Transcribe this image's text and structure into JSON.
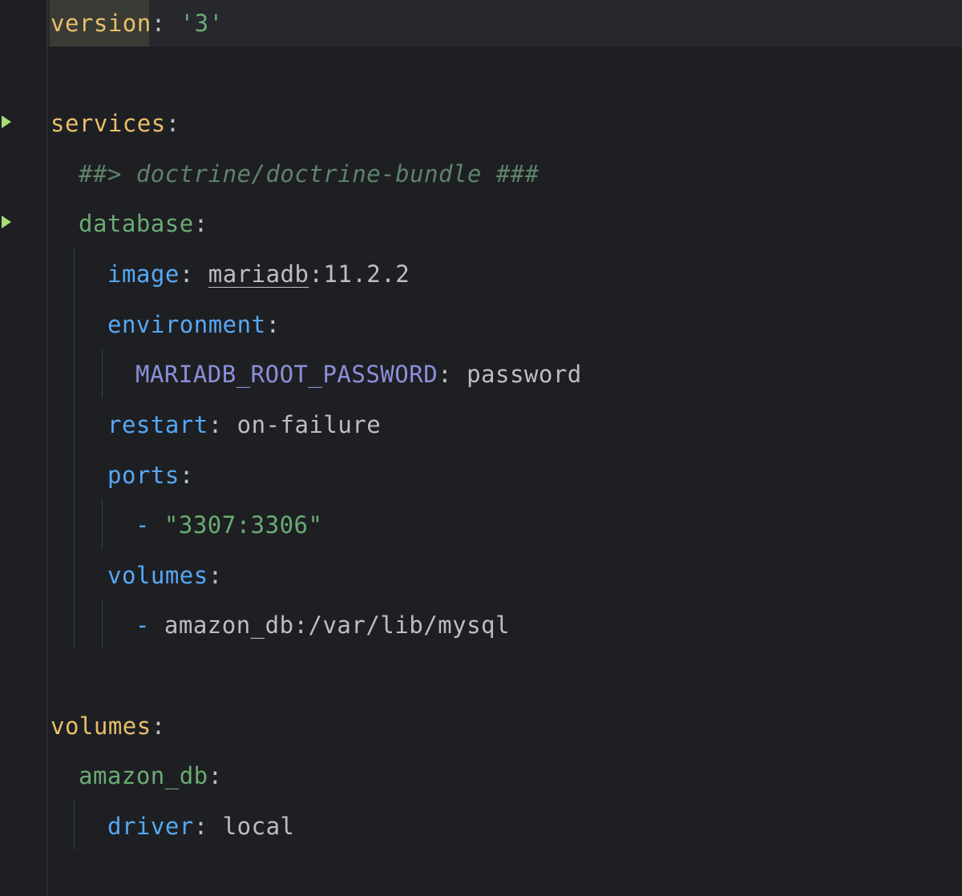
{
  "yaml": {
    "version": {
      "key": "version",
      "colon": ":",
      "value": "'3'"
    },
    "services": {
      "key": "services",
      "colon": ":"
    },
    "comment": "##> doctrine/doctrine-bundle ###",
    "database": {
      "key": "database",
      "colon": ":"
    },
    "image": {
      "key": "image",
      "colon": ": ",
      "value_name": "mariadb",
      "value_tag": ":11.2.2"
    },
    "environment": {
      "key": "environment",
      "colon": ":"
    },
    "root_password": {
      "key": "MARIADB_ROOT_PASSWORD",
      "colon": ": ",
      "value": "password"
    },
    "restart": {
      "key": "restart",
      "colon": ": ",
      "value": "on-failure"
    },
    "ports": {
      "key": "ports",
      "colon": ":",
      "dash": "- ",
      "item": "\"3307:3306\""
    },
    "service_volumes": {
      "key": "volumes",
      "colon": ":",
      "dash": "- ",
      "item": "amazon_db:/var/lib/mysql"
    },
    "volumes": {
      "key": "volumes",
      "colon": ":"
    },
    "amazon_db": {
      "key": "amazon_db",
      "colon": ":"
    },
    "driver": {
      "key": "driver",
      "colon": ": ",
      "value": "local"
    }
  },
  "colors": {
    "background": "#1e1f22",
    "top_level_key": "#e8bf6a",
    "nested_key": "#6aab73",
    "property_key": "#56a8f5",
    "env_key": "#8b8fdb",
    "comment": "#5f826b",
    "run_marker": "#a9dc76"
  },
  "icons": [
    "run-gutter-icon"
  ]
}
